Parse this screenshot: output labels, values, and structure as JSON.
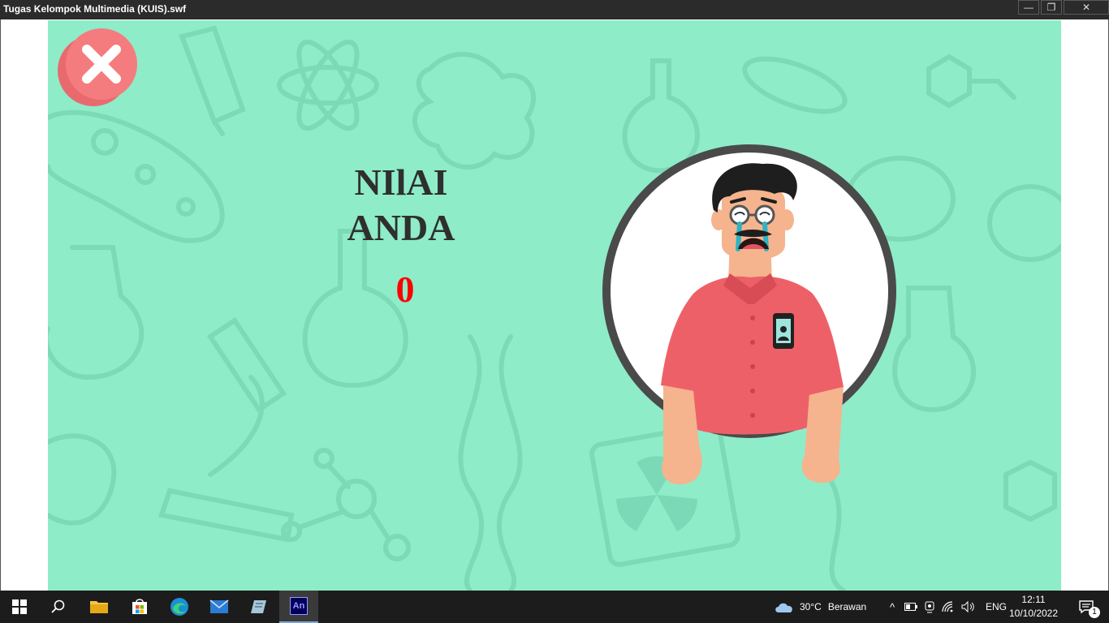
{
  "window": {
    "title": "Tugas Kelompok Multimedia (KUIS).swf",
    "minimize": "—",
    "restore": "❐",
    "close": "✕"
  },
  "result": {
    "heading_line1": "NIlAI",
    "heading_line2": "ANDA",
    "score": "0"
  },
  "taskbar": {
    "weather_temp": "30°C",
    "weather_desc": "Berawan",
    "language": "ENG",
    "time": "12:11",
    "date": "10/10/2022",
    "notification_count": "1",
    "animate_label": "An"
  },
  "colors": {
    "stage_bg": "#8eecc9",
    "score_color": "#ff0000",
    "close_button": "#f47c7e",
    "shirt": "#ee6068"
  }
}
